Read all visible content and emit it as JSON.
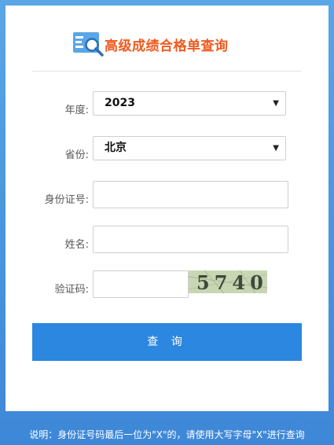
{
  "header": {
    "title": "高级成绩合格单查询",
    "logo_icon": "search-document-icon"
  },
  "form": {
    "year": {
      "label": "年度:",
      "value": "2023"
    },
    "province": {
      "label": "省份:",
      "value": "北京"
    },
    "id_number": {
      "label": "身份证号:",
      "value": "",
      "placeholder": ""
    },
    "name": {
      "label": "姓名:",
      "value": "",
      "placeholder": ""
    },
    "captcha": {
      "label": "验证码:",
      "value": "",
      "image_text": "5740"
    }
  },
  "actions": {
    "query_label": "查 询"
  },
  "note": "说明：身份证号码最后一位为\"X\"的，请使用大写字母\"X\"进行查询",
  "colors": {
    "accent": "#2b87df",
    "title": "#f05a1e",
    "background": "#4b98df"
  }
}
